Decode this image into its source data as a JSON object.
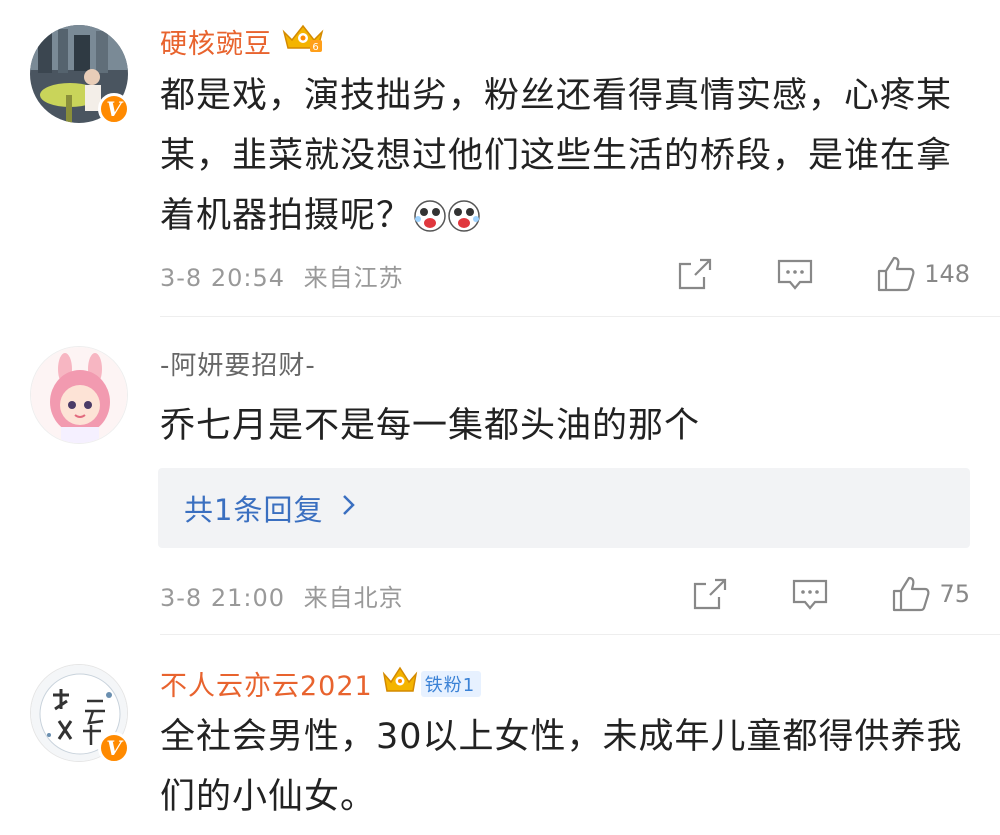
{
  "comments": [
    {
      "username": "硬核豌豆",
      "text": "都是戏，演技拙劣，粉丝还看得真情实感，心疼某某，韭菜就没想过他们这些生活的桥段，是谁在拿着机器拍摄呢？",
      "time": "3-8 20:54",
      "location": "来自江苏",
      "likes": "148",
      "verified": "V"
    },
    {
      "username": "-阿妍要招财-",
      "text": "乔七月是不是每一集都头油的那个",
      "reply_label": "共1条回复",
      "time": "3-8 21:00",
      "location": "来自北京",
      "likes": "75"
    },
    {
      "username": "不人云亦云2021",
      "fan_badge": "铁粉1",
      "text": "全社会男性，30以上女性，未成年儿童都得供养我们的小仙女。",
      "verified": "V"
    }
  ],
  "colors": {
    "username_accent": "#e8632e",
    "link_blue": "#3a6fc0",
    "meta_gray": "#999999",
    "verified_orange": "#ff8a00"
  },
  "icons": [
    "crown-badge-icon",
    "share-icon",
    "comment-icon",
    "like-icon",
    "chevron-right-icon",
    "laughing-emoji-icon"
  ]
}
